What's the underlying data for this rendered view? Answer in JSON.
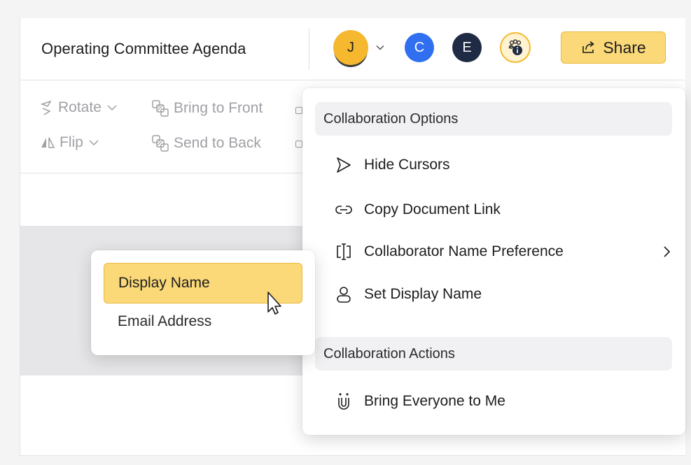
{
  "header": {
    "doc_title": "Operating Committee Agenda",
    "avatars": [
      {
        "initial": "J",
        "color": "#f5b82e",
        "icon": "user-avatar"
      },
      {
        "initial": "C",
        "color": "#2f6ff0",
        "icon": "user-avatar"
      },
      {
        "initial": "E",
        "color": "#1f2a44",
        "icon": "user-avatar"
      }
    ],
    "collaborators_icon": "group-info-icon",
    "share_label": "Share",
    "accent_color": "#fbd978"
  },
  "toolbar": {
    "rotate": "Rotate",
    "flip": "Flip",
    "bring_to_front": "Bring to Front",
    "send_to_back": "Send to Back"
  },
  "collab_menu": {
    "section_options": "Collaboration Options",
    "hide_cursors": "Hide Cursors",
    "copy_link": "Copy Document Link",
    "name_preference": "Collaborator Name Preference",
    "set_display_name": "Set Display Name",
    "section_actions": "Collaboration Actions",
    "bring_everyone": "Bring Everyone to Me"
  },
  "name_submenu": {
    "items": [
      "Display Name",
      "Email Address"
    ],
    "selected": "Display Name"
  }
}
